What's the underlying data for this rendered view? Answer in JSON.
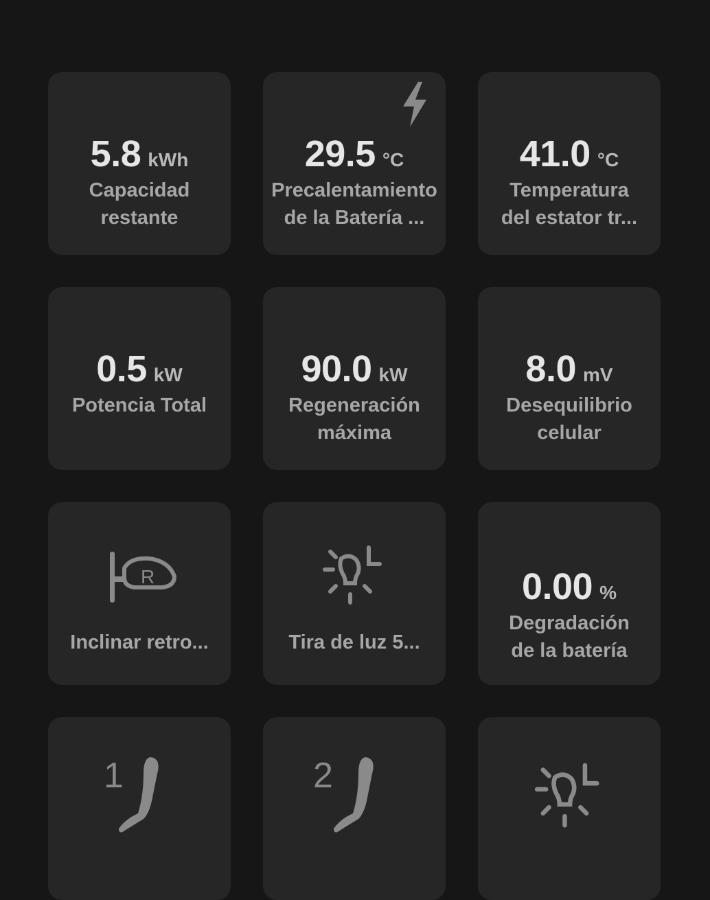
{
  "tiles": {
    "capacity": {
      "value": "5.8",
      "unit": "kWh",
      "label": "Capacidad\nrestante"
    },
    "preheat": {
      "value": "29.5",
      "unit": "°C",
      "label": "Precalentamiento\nde la Batería ..."
    },
    "stator": {
      "value": "41.0",
      "unit": "°C",
      "label": "Temperatura\ndel estator tr..."
    },
    "power": {
      "value": "0.5",
      "unit": "kW",
      "label": "Potencia Total"
    },
    "regen": {
      "value": "90.0",
      "unit": "kW",
      "label": "Regeneración\nmáxima"
    },
    "imbalance": {
      "value": "8.0",
      "unit": "mV",
      "label": "Desequilibrio\ncelular"
    },
    "mirror": {
      "label": "Inclinar retro...",
      "icon": "mirror-tilt-icon"
    },
    "lightstrip": {
      "label": "Tira de luz 5...",
      "icon": "light-strip-left-icon"
    },
    "degradation": {
      "value": "0.00",
      "unit": "%",
      "label": "Degradación\nde la batería"
    },
    "seat1": {
      "icon": "seat-position-1-icon",
      "number": "1"
    },
    "seat2": {
      "icon": "seat-position-2-icon",
      "number": "2"
    },
    "light2": {
      "icon": "light-strip-left-icon"
    }
  },
  "colors": {
    "background": "#161616",
    "tile": "#262626",
    "value": "#e6e6e6",
    "label": "#a6a6a6",
    "icon": "#8a8a8a"
  }
}
